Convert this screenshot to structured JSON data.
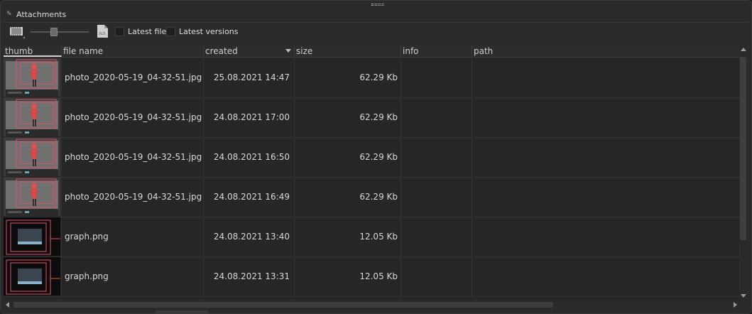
{
  "panel": {
    "title": "Attachments",
    "pin_icon": "pin-icon"
  },
  "toolbar": {
    "film_icon": "film-strip-icon",
    "xls_icon": "xls-file-icon",
    "xls_text": "XLS",
    "thumb_size_slider": 0.4,
    "latest_file_label": "Latest file",
    "latest_file_checked": false,
    "latest_versions_label": "Latest versions",
    "latest_versions_checked": false
  },
  "table": {
    "columns": [
      {
        "key": "thumb",
        "label": "thumb"
      },
      {
        "key": "name",
        "label": "file name"
      },
      {
        "key": "created",
        "label": "created",
        "sorted": "desc"
      },
      {
        "key": "size",
        "label": "size"
      },
      {
        "key": "info",
        "label": "info"
      },
      {
        "key": "path",
        "label": "path"
      }
    ],
    "rows": [
      {
        "thumb": "photo-thumbnail",
        "name": "photo_2020-05-19_04-32-51.jpg",
        "created": "25.08.2021 14:47",
        "size": "62.29 Kb",
        "info": "",
        "path": ""
      },
      {
        "thumb": "photo-thumbnail",
        "name": "photo_2020-05-19_04-32-51.jpg",
        "created": "24.08.2021 17:00",
        "size": "62.29 Kb",
        "info": "",
        "path": ""
      },
      {
        "thumb": "photo-thumbnail",
        "name": "photo_2020-05-19_04-32-51.jpg",
        "created": "24.08.2021 16:50",
        "size": "62.29 Kb",
        "info": "",
        "path": ""
      },
      {
        "thumb": "photo-thumbnail",
        "name": "photo_2020-05-19_04-32-51.jpg",
        "created": "24.08.2021 16:49",
        "size": "62.29 Kb",
        "info": "",
        "path": ""
      },
      {
        "thumb": "graph-thumbnail",
        "name": "graph.png",
        "created": "24.08.2021 13:40",
        "size": "12.05 Kb",
        "info": "",
        "path": ""
      },
      {
        "thumb": "graph-thumbnail",
        "name": "graph.png",
        "created": "24.08.2021 13:31",
        "size": "12.05 Kb",
        "info": "",
        "path": ""
      }
    ]
  },
  "colors": {
    "background": "#2b2b2b",
    "grid": "#262626",
    "highlight_frame": "#e0506a",
    "figure_red": "#e05050"
  }
}
